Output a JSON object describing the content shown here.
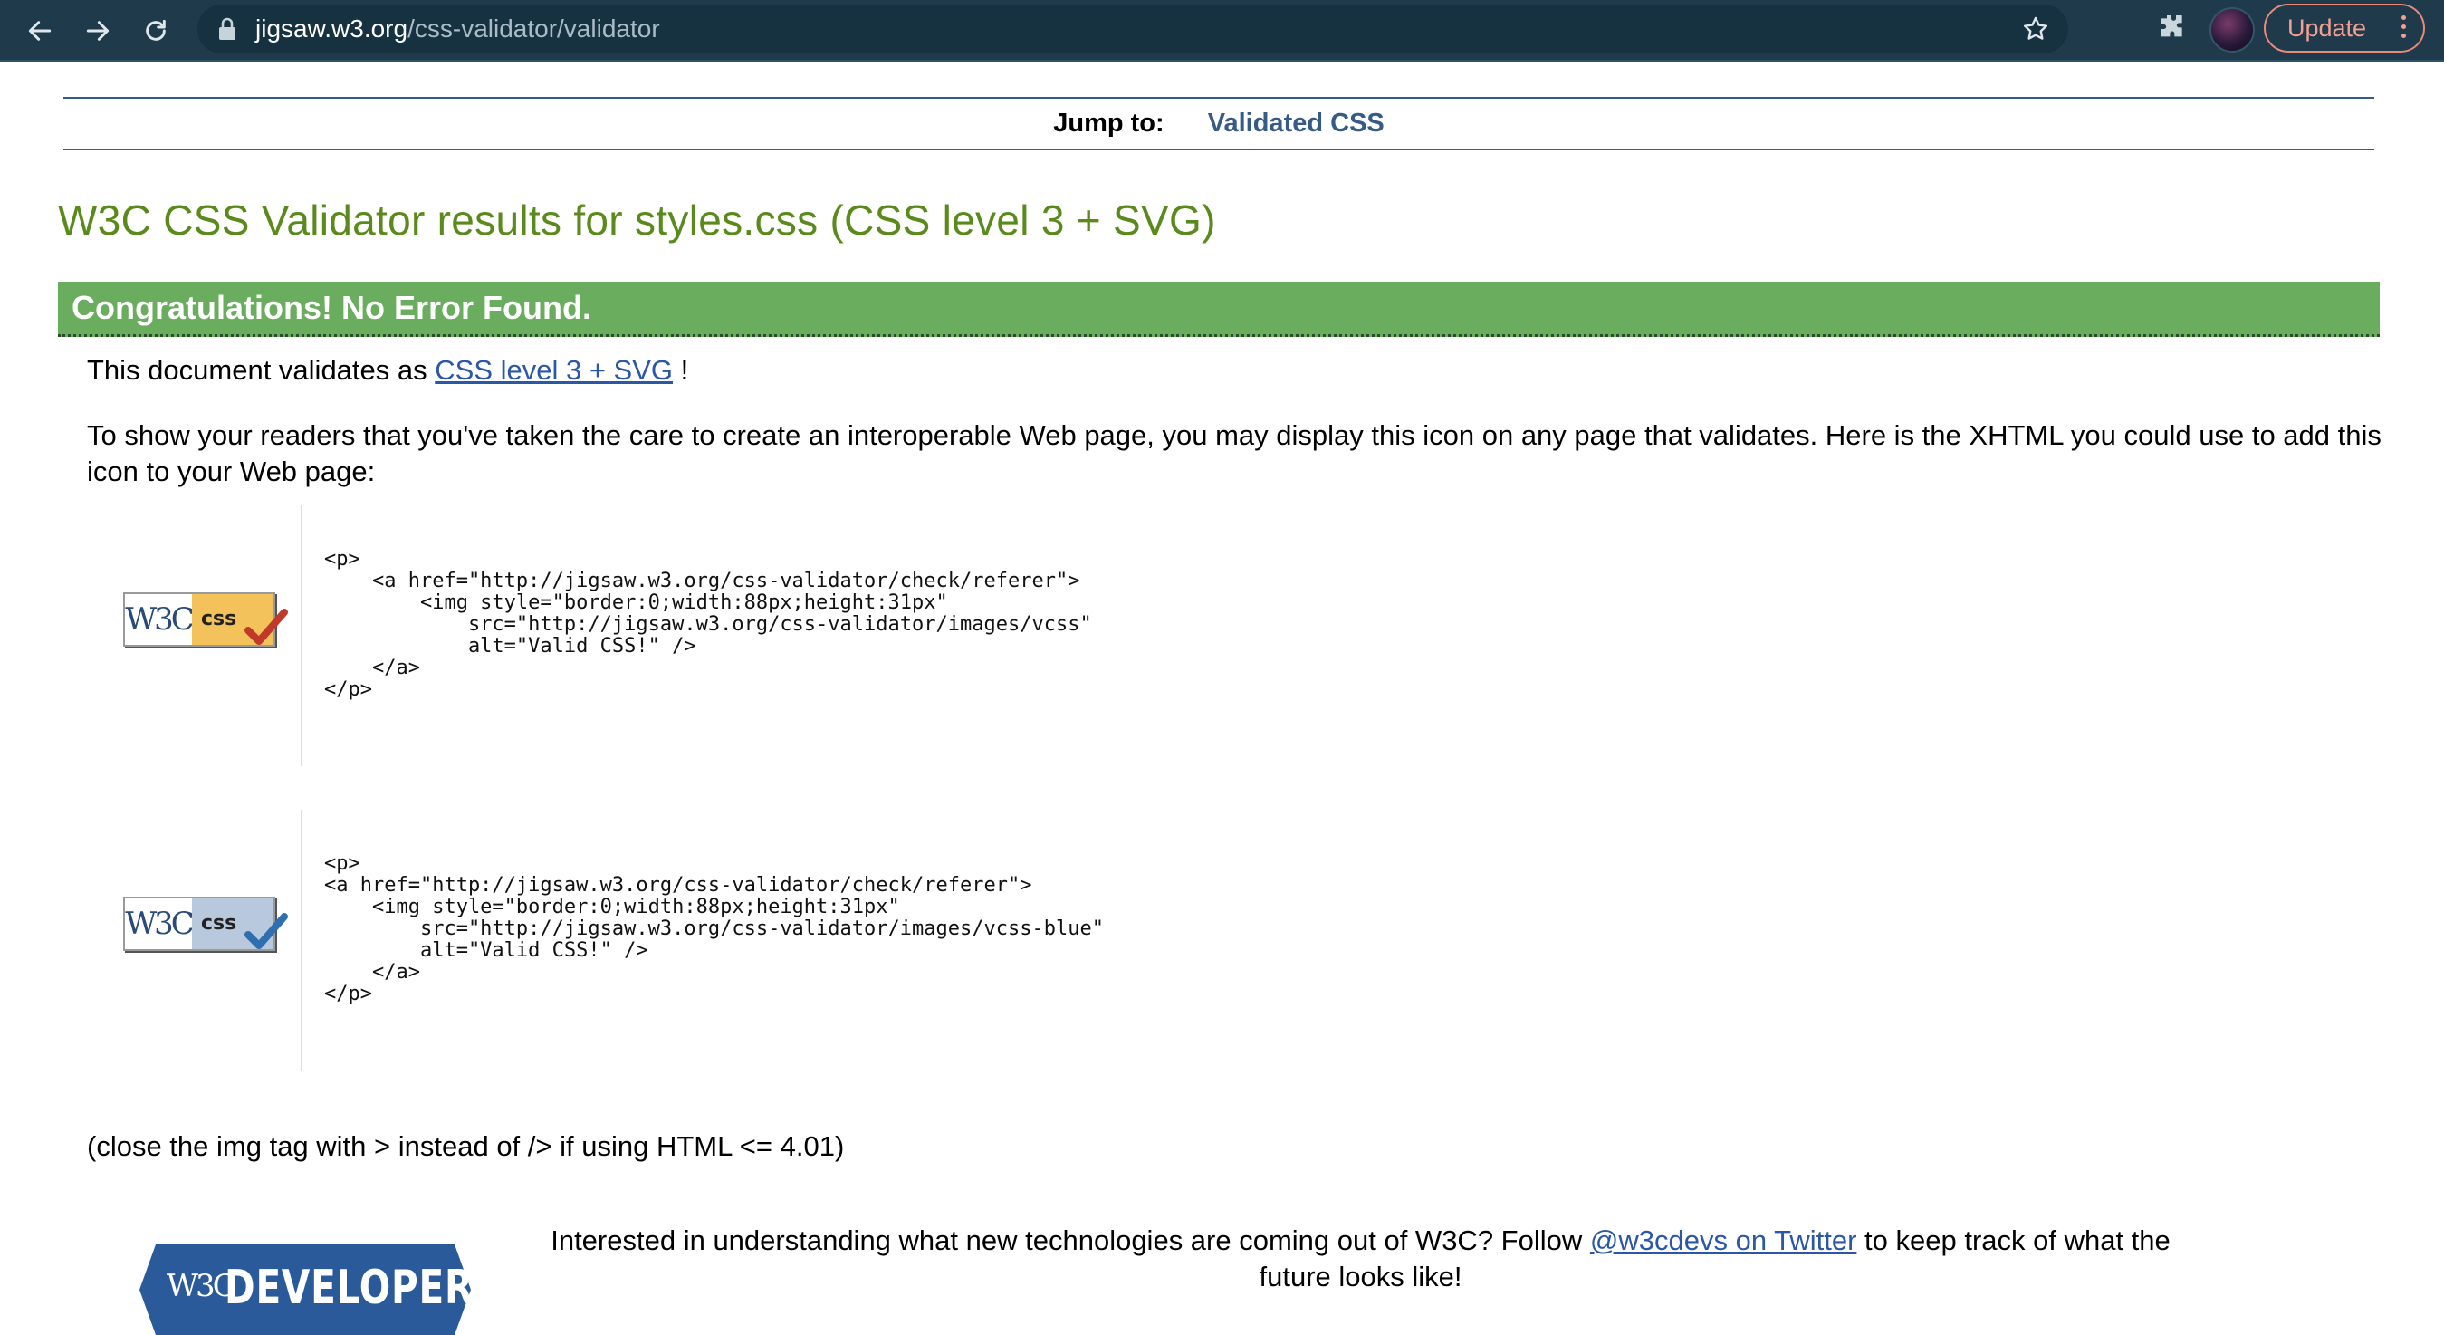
{
  "browser": {
    "url_host": "jigsaw.w3.org",
    "url_path": "/css-validator/validator",
    "update_label": "Update"
  },
  "jump": {
    "label": "Jump to:",
    "link": "Validated CSS"
  },
  "title": "W3C CSS Validator results for styles.css (CSS level 3 + SVG)",
  "congrats": "Congratulations! No Error Found.",
  "validates": {
    "prefix": "This document validates as",
    "link": "CSS level 3 + SVG",
    "suffix": "!"
  },
  "show_icon_text": "To show your readers that you've taken the care to create an interoperable Web page, you may display this icon on any page that validates. Here is the XHTML you could use to add this icon to your Web page:",
  "badges": [
    {
      "w3c_text": "W3C",
      "css_text": "css",
      "code": "<p>\n    <a href=\"http://jigsaw.w3.org/css-validator/check/referer\">\n        <img style=\"border:0;width:88px;height:31px\"\n            src=\"http://jigsaw.w3.org/css-validator/images/vcss\"\n            alt=\"Valid CSS!\" />\n    </a>\n</p>",
      "check_color": "#c0392b"
    },
    {
      "w3c_text": "W3C",
      "css_text": "css",
      "code": "<p>\n<a href=\"http://jigsaw.w3.org/css-validator/check/referer\">\n    <img style=\"border:0;width:88px;height:31px\"\n        src=\"http://jigsaw.w3.org/css-validator/images/vcss-blue\"\n        alt=\"Valid CSS!\" />\n    </a>\n</p>",
      "check_color": "#2f6fb0"
    }
  ],
  "close_note": "(close the img tag with > instead of /> if using HTML <= 4.01)",
  "footer": {
    "logo_w3c": "W3C",
    "logo_text": "DEVELOPERS",
    "text_before": "Interested in understanding what new technologies are coming out of W3C? Follow",
    "link": "@w3cdevs on Twitter",
    "text_after": "to keep track of what the future looks like!"
  },
  "colors": {
    "chrome_bg": "#1f3a4a",
    "title_green": "#5b8a1c",
    "congrats_bg": "#6aad5e",
    "link_blue": "#2b57a8",
    "jump_blue": "#355b86",
    "footer_logo_blue": "#2a5a9a"
  },
  "icons": [
    "back-arrow-icon",
    "forward-arrow-icon",
    "reload-icon",
    "lock-icon",
    "star-icon",
    "puzzle-icon",
    "kebab-menu-icon",
    "check-icon"
  ]
}
